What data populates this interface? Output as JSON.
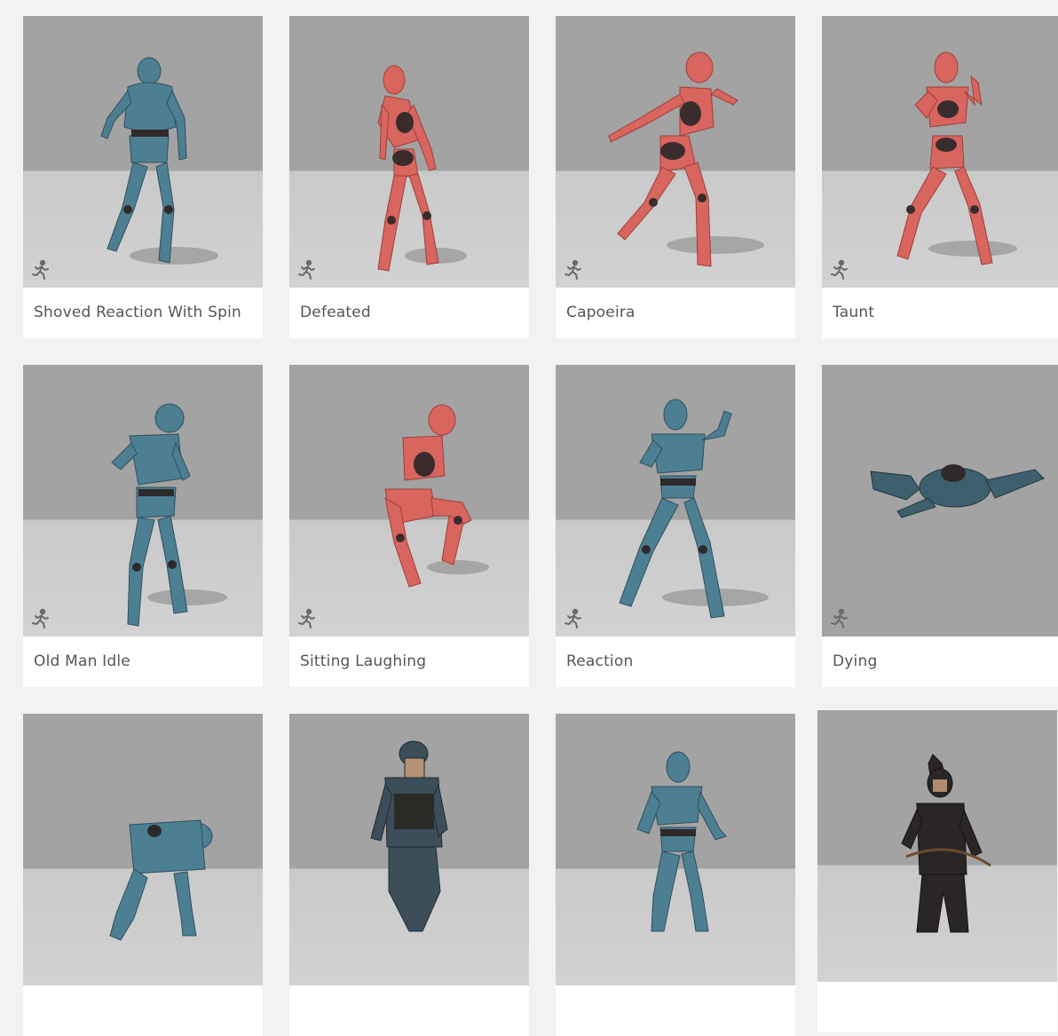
{
  "colors": {
    "page_bg": "#f2f2f2",
    "blue_body": "#4d7f93",
    "red_body": "#d9655f",
    "joint": "#3a3030",
    "label_text": "#555555"
  },
  "icons": {
    "animation": "running-figure-icon"
  },
  "cards": [
    {
      "title": "Shoved Reaction With Spin",
      "character": "blue-mannequin"
    },
    {
      "title": "Defeated",
      "character": "red-mannequin"
    },
    {
      "title": "Capoeira",
      "character": "red-mannequin"
    },
    {
      "title": "Taunt",
      "character": "red-mannequin"
    },
    {
      "title": "Old Man Idle",
      "character": "blue-mannequin"
    },
    {
      "title": "Sitting Laughing",
      "character": "red-mannequin"
    },
    {
      "title": "Reaction",
      "character": "blue-mannequin"
    },
    {
      "title": "Dying",
      "character": "soldier"
    },
    {
      "title": "",
      "character": "blue-mannequin"
    },
    {
      "title": "",
      "character": "soldier"
    },
    {
      "title": "",
      "character": "blue-mannequin"
    },
    {
      "title": "",
      "character": "archer"
    }
  ]
}
